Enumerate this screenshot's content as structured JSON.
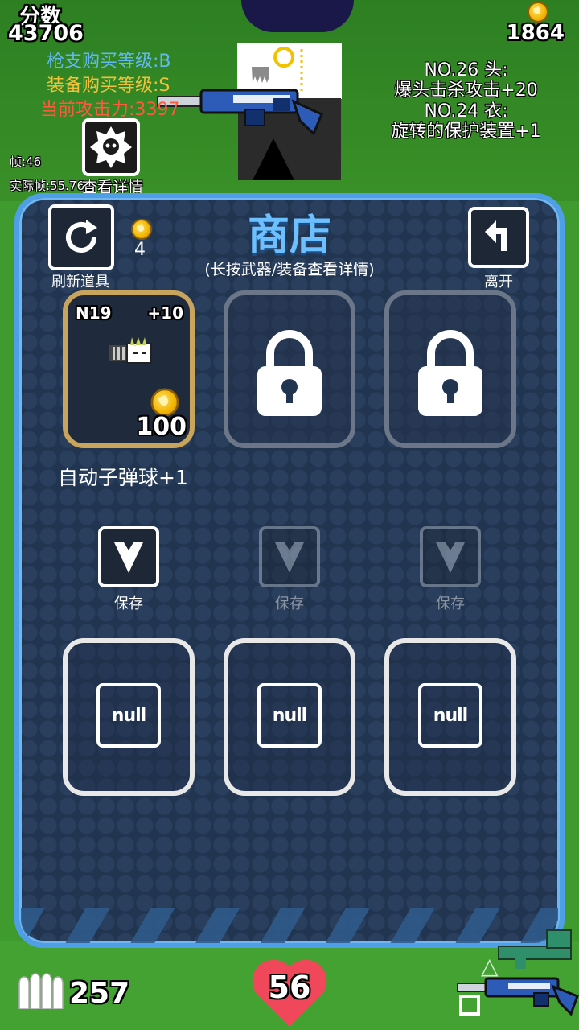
{
  "hud": {
    "score_label": "分数",
    "score_value": "43706",
    "gun_level": "枪支购买等级:B",
    "gear_level": "装备购买等级:S",
    "attack": "当前攻击力:3397",
    "gold": "1864",
    "fps": "帧:46",
    "real_fps": "实际帧:55.76",
    "details_label": "查看详情",
    "equip_head_title": "NO.26 头:",
    "equip_head_effect": "爆头击杀攻击+20",
    "equip_body_title": "NO.24 衣:",
    "equip_body_effect": "旋转的保护装置+1",
    "colors": {
      "gun_level": "#62b8f0",
      "gear_level": "#f0c23a",
      "attack": "#ff5a3c"
    }
  },
  "shop": {
    "title": "商店",
    "subtitle": "(长按武器/装备查看详情)",
    "refresh_label": "刷新道具",
    "refresh_cost": "4",
    "leave_label": "离开",
    "item": {
      "code": "N19",
      "bonus": "+10",
      "price": "100",
      "name": "自动子弹球+1",
      "icon": "auto-bullet-ball-icon"
    },
    "save_label": "保存",
    "null_label": "null",
    "colors": {
      "panel_border": "#4e9fe6",
      "panel_bg": "#223550",
      "title": "#6cc0ff",
      "item_border": "#c8a45c"
    }
  },
  "bottom": {
    "ammo": "257",
    "health": "56"
  }
}
